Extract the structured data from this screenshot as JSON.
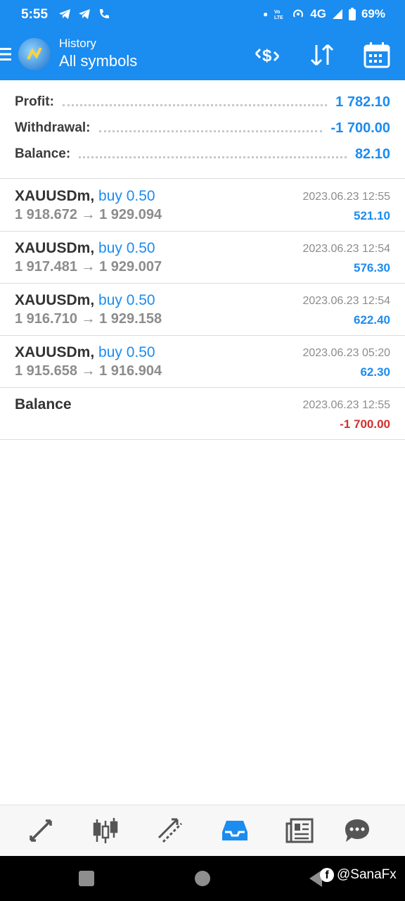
{
  "status_bar": {
    "time": "5:55",
    "network": "4G",
    "battery": "69%"
  },
  "app_bar": {
    "title": "History",
    "subtitle": "All symbols"
  },
  "summary": {
    "profit_label": "Profit:",
    "profit_value": "1 782.10",
    "withdrawal_label": "Withdrawal:",
    "withdrawal_value": "-1 700.00",
    "balance_label": "Balance:",
    "balance_value": "82.10"
  },
  "trades": [
    {
      "symbol": "XAUUSDm,",
      "side": "buy 0.50",
      "prices": "1 918.672 → 1 929.094",
      "time": "2023.06.23 12:55",
      "profit": "521.10"
    },
    {
      "symbol": "XAUUSDm,",
      "side": "buy 0.50",
      "prices": "1 917.481 → 1 929.007",
      "time": "2023.06.23 12:54",
      "profit": "576.30"
    },
    {
      "symbol": "XAUUSDm,",
      "side": "buy 0.50",
      "prices": "1 916.710 → 1 929.158",
      "time": "2023.06.23 12:54",
      "profit": "622.40"
    },
    {
      "symbol": "XAUUSDm,",
      "side": "buy 0.50",
      "prices": "1 915.658 → 1 916.904",
      "time": "2023.06.23 05:20",
      "profit": "62.30"
    }
  ],
  "balance_op": {
    "label": "Balance",
    "time": "2023.06.23 12:55",
    "amount": "-1 700.00"
  },
  "bottom_nav": {
    "items": [
      "quotes-icon",
      "chart-icon",
      "trade-icon",
      "history-icon",
      "news-icon",
      "chat-icon"
    ],
    "active": "history-icon"
  },
  "watermark": "@SanaFx",
  "colors": {
    "accent": "#1b8cf0",
    "negative": "#d32f2f",
    "text": "#333333",
    "muted": "#8c8c8c"
  }
}
